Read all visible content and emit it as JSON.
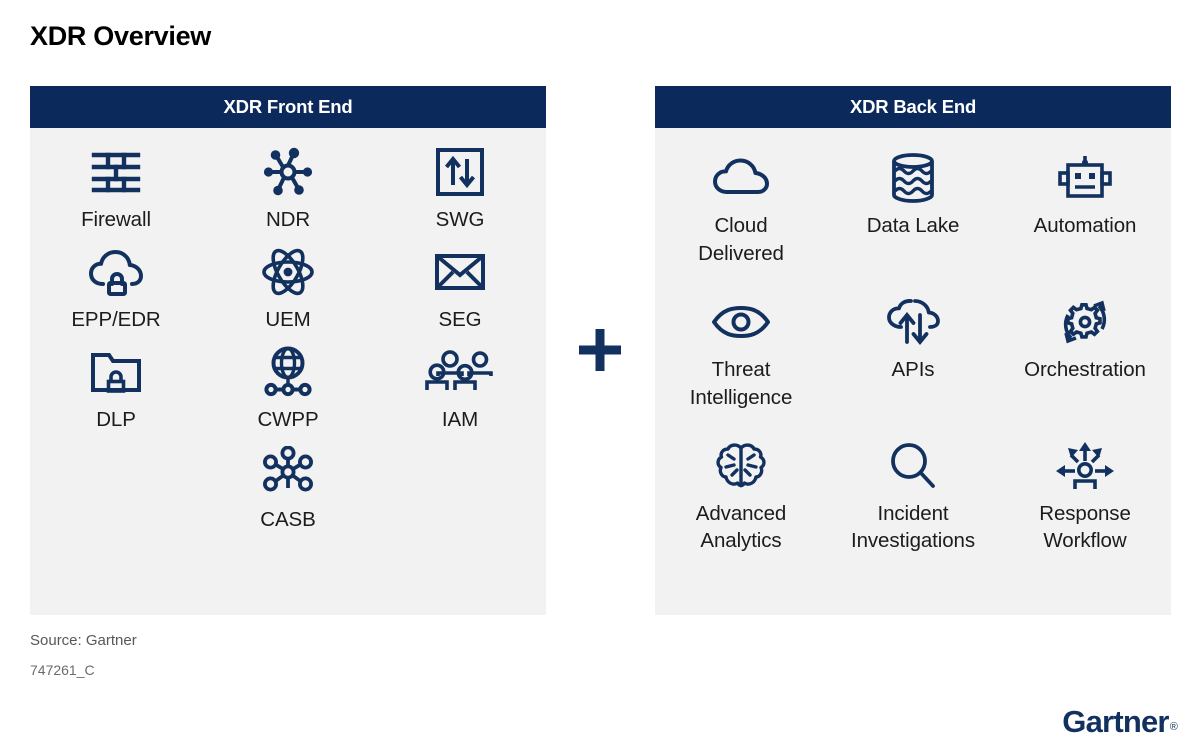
{
  "page": {
    "title": "XDR Overview",
    "source": "Source: Gartner",
    "doc_id": "747261_C",
    "plus_symbol": "+"
  },
  "colors": {
    "header_navy": "#0b2a5b",
    "panel_bg": "#f2f2f2",
    "icon_navy": "#12315f",
    "brand_navy": "#12315f",
    "title_black": "#000000"
  },
  "brand": {
    "name": "Gartner",
    "registered_mark": "®"
  },
  "panels": [
    {
      "id": "front-end",
      "header": "XDR Front End",
      "items": [
        {
          "label": "Firewall",
          "icon": "firewall-icon"
        },
        {
          "label": "NDR",
          "icon": "network-hub-icon"
        },
        {
          "label": "SWG",
          "icon": "gateway-arrows-icon"
        },
        {
          "label": "EPP/EDR",
          "icon": "cloud-lock-icon"
        },
        {
          "label": "UEM",
          "icon": "atom-icon"
        },
        {
          "label": "SEG",
          "icon": "envelope-icon"
        },
        {
          "label": "DLP",
          "icon": "folder-lock-icon"
        },
        {
          "label": "CWPP",
          "icon": "globe-network-icon"
        },
        {
          "label": "IAM",
          "icon": "people-group-icon"
        },
        {
          "label": "",
          "icon": ""
        },
        {
          "label": "CASB",
          "icon": "hub-nodes-icon"
        },
        {
          "label": "",
          "icon": ""
        }
      ]
    },
    {
      "id": "back-end",
      "header": "XDR Back End",
      "items": [
        {
          "label": "Cloud\nDelivered",
          "icon": "cloud-icon"
        },
        {
          "label": "Data Lake",
          "icon": "data-lake-icon"
        },
        {
          "label": "Automation",
          "icon": "robot-icon"
        },
        {
          "label": "Threat\nIntelligence",
          "icon": "eye-icon"
        },
        {
          "label": "APIs",
          "icon": "cloud-transfer-icon"
        },
        {
          "label": "Orchestration",
          "icon": "gear-cycle-icon"
        },
        {
          "label": "Advanced\nAnalytics",
          "icon": "brain-icon"
        },
        {
          "label": "Incident\nInvestigations",
          "icon": "magnifier-icon"
        },
        {
          "label": "Response\nWorkflow",
          "icon": "response-arrows-icon"
        }
      ]
    }
  ]
}
